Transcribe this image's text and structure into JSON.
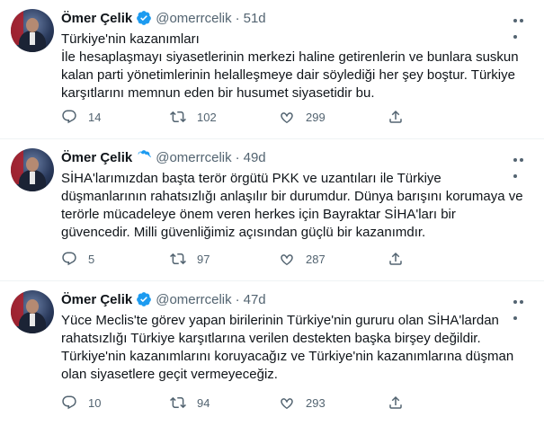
{
  "tweets": [
    {
      "name": "Ömer Çelik",
      "handle": "@omerrcelik",
      "dot": "·",
      "time": "51d",
      "lines": [
        "Türkiye'nin kazanımları",
        "İle hesaplaşmayı siyasetlerinin merkezi haline getirenlerin ve bunlara suskun",
        "kalan parti yönetimlerinin helalleşmeye dair söylediği her şey boştur. Türkiye",
        "karşıtlarını memnun eden bir husumet siyasetidir bu."
      ],
      "replies": "14",
      "retweets": "102",
      "likes": "299"
    },
    {
      "name": "Ömer Çelik",
      "handle": "@omerrcelik",
      "dot": "·",
      "time": "49d",
      "lines": [
        "SİHA'larımızdan başta terör örgütü PKK ve uzantıları ile Türkiye",
        "düşmanlarının rahatsızlığı anlaşılır bir durumdur. Dünya barışını korumaya ve",
        "terörle mücadeleye önem veren herkes için Bayraktar SİHA'ları bir",
        "güvencedir. Milli güvenliğimiz açısından güçlü bir kazanımdır."
      ],
      "replies": "5",
      "retweets": "97",
      "likes": "287"
    },
    {
      "name": "Ömer Çelik",
      "handle": "@omerrcelik",
      "dot": "·",
      "time": "47d",
      "lines": [
        "Yüce Meclis'te görev yapan birilerinin Türkiye'nin gururu olan SİHA'lardan",
        "rahatsızlığı Türkiye karşıtlarına verilen destekten başka birşey değildir.",
        "Türkiye'nin kazanımlarını koruyacağız ve Türkiye'nin kazanımlarına düşman",
        "olan siyasetlere geçit vermeyeceğiz."
      ],
      "replies": "10",
      "retweets": "94",
      "likes": "293"
    }
  ],
  "colors": {
    "accent": "#1d9bf0",
    "muted": "#536471",
    "border": "#eff3f4"
  },
  "icons": {
    "reply": "reply-icon",
    "retweet": "retweet-icon",
    "like": "heart-icon",
    "share": "share-icon",
    "verified": "verified-badge-icon",
    "more": "more-options-icon"
  }
}
